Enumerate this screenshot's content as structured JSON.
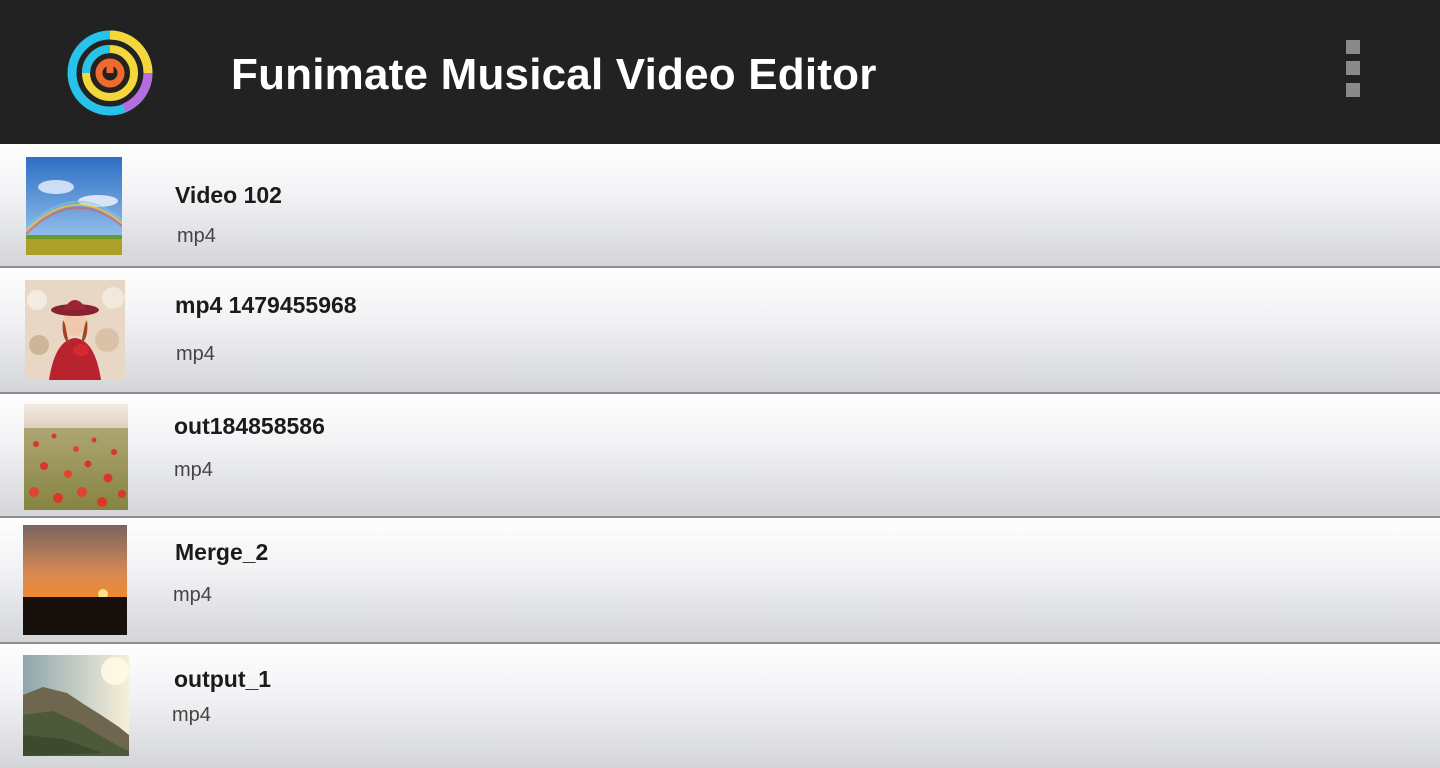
{
  "app": {
    "title": "Funimate Musical Video Editor",
    "icons": {
      "logo": "funimate-spiral-logo",
      "menu": "more-vertical-icon"
    },
    "colors": {
      "header_bg": "#222222",
      "title_text": "#ffffff"
    }
  },
  "videos": [
    {
      "name": "Video 102",
      "format": "mp4",
      "thumbnail": "rainbow-meadow"
    },
    {
      "name": "mp4 1479455968",
      "format": "mp4",
      "thumbnail": "woman-red-hat"
    },
    {
      "name": "out184858586",
      "format": "mp4",
      "thumbnail": "poppy-field"
    },
    {
      "name": "Merge_2",
      "format": "mp4",
      "thumbnail": "sunset"
    },
    {
      "name": "output_1",
      "format": "mp4",
      "thumbnail": "cliff-coast"
    }
  ]
}
